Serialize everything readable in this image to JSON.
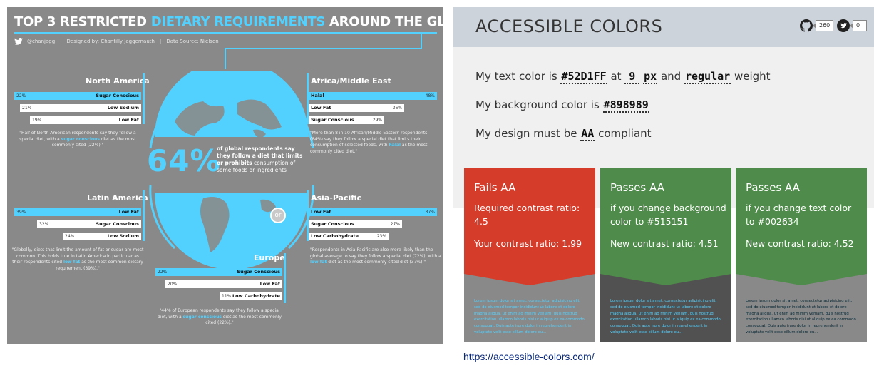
{
  "infographic": {
    "title_prefix": "TOP 3 RESTRICTED ",
    "title_highlight": "DIETARY REQUIREMENTS",
    "title_suffix": " AROUND THE GLOBE",
    "handle": "@chanjagg",
    "designer": "Designed by: Chantilly Jaggernauth",
    "source": "Data Source: Nielsen",
    "big_percent": "64%",
    "center_text_bold": "of global respondents say they follow a diet that limits or prohibits",
    "center_text_rest": " consumption of some foods or ingredients",
    "colors": {
      "background": "#898989",
      "accent": "#52D1FF"
    },
    "regions": [
      {
        "name": "North America",
        "bars": [
          {
            "label": "Sugar Conscious",
            "percent": "22%",
            "value": 22,
            "highlight": true
          },
          {
            "label": "Low Sodium",
            "percent": "21%",
            "value": 21,
            "highlight": false
          },
          {
            "label": "Low Fat",
            "percent": "19%",
            "value": 19,
            "highlight": false
          }
        ],
        "quote_a": "\"Half of North American respondents say they follow a special diet, with a ",
        "quote_hl": "sugar conscious",
        "quote_b": " diet as the most commonly cited (22%).\""
      },
      {
        "name": "Africa/Middle East",
        "bars": [
          {
            "label": "Halal",
            "percent": "48%",
            "value": 48,
            "highlight": true
          },
          {
            "label": "Low Fat",
            "percent": "36%",
            "value": 36,
            "highlight": false
          },
          {
            "label": "Sugar Conscious",
            "percent": "29%",
            "value": 29,
            "highlight": false
          }
        ],
        "quote_a": "\"More than 8 in 10 African/Middle Eastern respondents (84%) say they follow a special diet that limits their consumption of selected foods, with ",
        "quote_hl": "halal",
        "quote_b": " as the most commonly cited diet.\""
      },
      {
        "name": "Latin America",
        "bars": [
          {
            "label": "Low Fat",
            "percent": "39%",
            "value": 39,
            "highlight": true
          },
          {
            "label": "Sugar Conscious",
            "percent": "32%",
            "value": 32,
            "highlight": false
          },
          {
            "label": "Low Sodium",
            "percent": "24%",
            "value": 24,
            "highlight": false
          }
        ],
        "quote_a": "\"Globally, diets that limit the amount of fat or sugar are most common. This holds true in Latin America in particular as their respondents cited ",
        "quote_hl": "low fat",
        "quote_b": " as the most common dietary requirement (39%).\""
      },
      {
        "name": "Asia-Pacific",
        "bars": [
          {
            "label": "Low Fat",
            "percent": "37%",
            "value": 37,
            "highlight": true
          },
          {
            "label": "Sugar Conscious",
            "percent": "27%",
            "value": 27,
            "highlight": false
          },
          {
            "label": "Low Carbohydrate",
            "percent": "23%",
            "value": 23,
            "highlight": false
          }
        ],
        "quote_a": "\"Respondents in Asia-Pacific are also more likely than the global average to say they follow a special diet (72%), with a ",
        "quote_hl": "low fat",
        "quote_b": " diet as the most commonly cited diet (37%).\""
      },
      {
        "name": "Europe",
        "bars": [
          {
            "label": "Sugar Conscious",
            "percent": "22%",
            "value": 22,
            "highlight": true
          },
          {
            "label": "Low Fat",
            "percent": "20%",
            "value": 20,
            "highlight": false
          },
          {
            "label": "Low Carbohydrate",
            "percent": "11%",
            "value": 11,
            "highlight": false
          }
        ],
        "quote_a": "\"44% of European respondents say they follow a special diet, with a ",
        "quote_hl": "sugar conscious",
        "quote_b": " diet as the most commonly cited (22%).\""
      }
    ]
  },
  "accessible": {
    "brand": "ACCESSIBLE COLORS",
    "github_count": "260",
    "twitter_count": "0",
    "line1_pre": "My text color is",
    "text_color": "#52D1FF",
    "line1_at": "at",
    "size": "9",
    "unit": "px",
    "line1_and": "and",
    "weight": "regular",
    "line1_post": "weight",
    "line2_pre": "My background color is",
    "bg_color": "#898989",
    "line3_pre": "My design must be",
    "level": "AA",
    "line3_post": "compliant",
    "or": "or",
    "lorem": "Lorem ipsum dolor sit amet, consectetur adipisicing elit, sed do eiusmod tempor incididunt ut labore et dolore magna aliqua. Ut enim ad minim veniam, quis nostrud exercitation ullamco laboris nisi ut aliquip ex ea commodo consequat. Duis aute irure dolor in reprehenderit in voluptate velit esse cillum dolore eu...",
    "cards": [
      {
        "title": "Fails AA",
        "line1": "Required contrast ratio: 4.5",
        "line2": "Your contrast ratio: 1.99",
        "color": "#d63c2a",
        "preview_bg": "#898989",
        "preview_text": "#52D1FF"
      },
      {
        "title": "Passes AA",
        "line1": "if you change background color to #515151",
        "line2": "New contrast ratio: 4.51",
        "color": "#4f8b4a",
        "preview_bg": "#515151",
        "preview_text": "#52D1FF"
      },
      {
        "title": "Passes AA",
        "line1": "if you change text color to #002634",
        "line2": "New contrast ratio: 4.52",
        "color": "#4f8b4a",
        "preview_bg": "#898989",
        "preview_text": "#002634"
      }
    ]
  },
  "url": "https://accessible-colors.com/"
}
